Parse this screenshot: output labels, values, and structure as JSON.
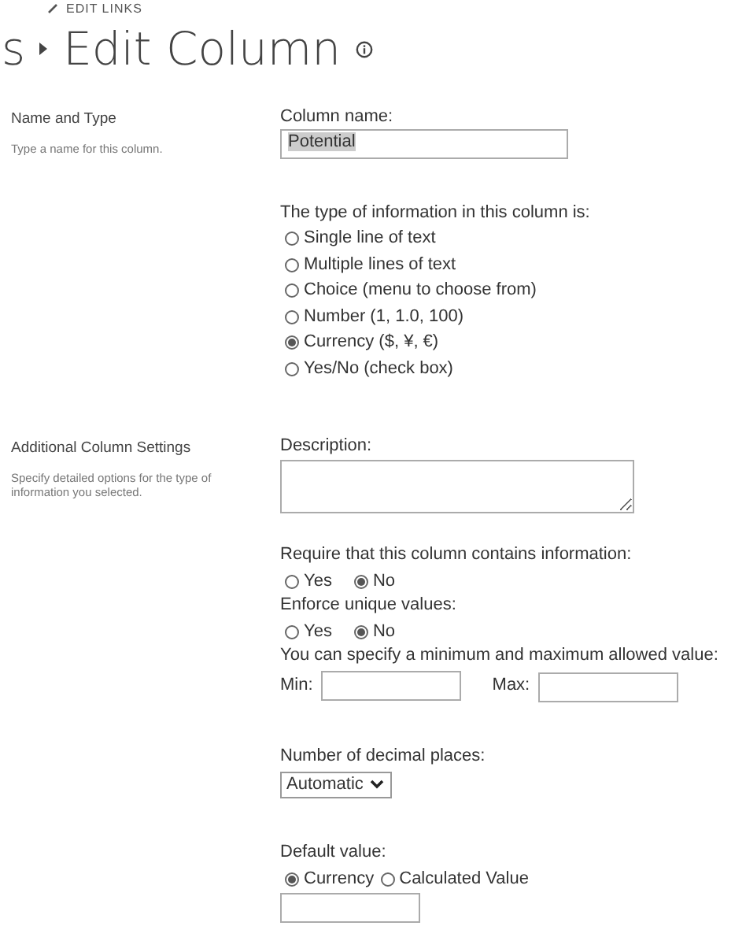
{
  "top_link": {
    "label": "EDIT LINKS"
  },
  "breadcrumb": {
    "parent": "s",
    "title": "Edit Column"
  },
  "sections": [
    {
      "title": "Name and Type",
      "description": "Type a name for this column.",
      "fields": [
        {
          "kind": "text",
          "label": "Column name:",
          "value": "Potential"
        },
        {
          "kind": "radio_list",
          "label": "The type of information in this column is:",
          "options": [
            {
              "label": "Single line of text",
              "selected": false
            },
            {
              "label": "Multiple lines of text",
              "selected": false
            },
            {
              "label": "Choice (menu to choose from)",
              "selected": false
            },
            {
              "label": "Number (1, 1.0, 100)",
              "selected": false
            },
            {
              "label": "Currency ($, ¥, €)",
              "selected": true
            },
            {
              "label": "Yes/No (check box)",
              "selected": false
            }
          ]
        }
      ]
    },
    {
      "title": "Additional Column Settings",
      "description": "Specify detailed options for the type of information you selected.",
      "fields": [
        {
          "kind": "textarea",
          "label": "Description:"
        },
        {
          "kind": "radio_row",
          "label": "Require that this column contains information:",
          "options": [
            {
              "label": "Yes",
              "selected": false
            },
            {
              "label": "No",
              "selected": true
            }
          ]
        },
        {
          "kind": "radio_row",
          "label": "Enforce unique values:",
          "options": [
            {
              "label": "Yes",
              "selected": false
            },
            {
              "label": "No",
              "selected": true
            }
          ]
        },
        {
          "kind": "range",
          "label": "You can specify a minimum and maximum allowed value:",
          "min_label": "Min:",
          "max_label": "Max:"
        },
        {
          "kind": "select",
          "label": "Number of decimal places:",
          "value": "Automatic"
        },
        {
          "kind": "radio_inline",
          "label": "Default value:",
          "options": [
            {
              "label": "Currency",
              "selected": true
            },
            {
              "label": "Calculated Value",
              "selected": false
            }
          ]
        },
        {
          "kind": "blank_input"
        }
      ]
    }
  ]
}
